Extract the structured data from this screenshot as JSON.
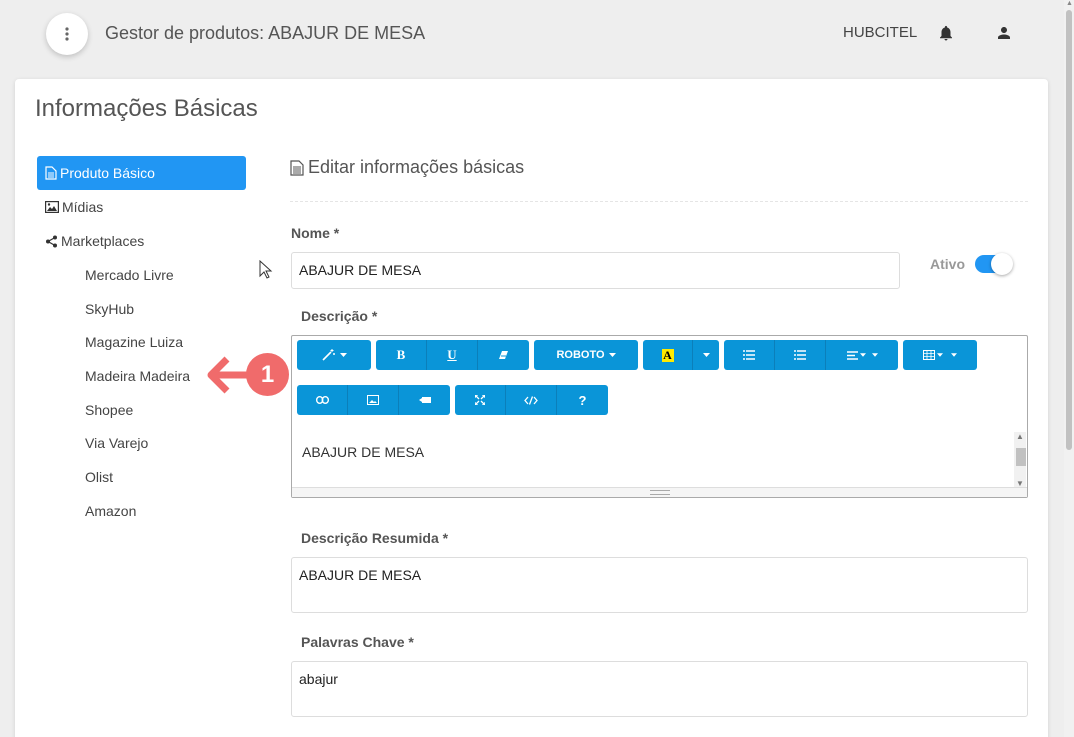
{
  "header": {
    "title": "Gestor de produtos: ABAJUR DE MESA",
    "org": "HUBCITEL"
  },
  "card": {
    "title": "Informações Básicas"
  },
  "sidebar": {
    "items": [
      {
        "label": "Produto Básico",
        "icon": "file-icon",
        "active": true
      },
      {
        "label": "Mídias",
        "icon": "image-icon"
      },
      {
        "label": "Marketplaces",
        "icon": "share-icon"
      }
    ],
    "marketplaces": [
      "Mercado Livre",
      "SkyHub",
      "Magazine Luiza",
      "Madeira Madeira",
      "Shopee",
      "Via Varejo",
      "Olist",
      "Amazon"
    ]
  },
  "annotation": {
    "badge": "1"
  },
  "form": {
    "section_title": "Editar informações básicas",
    "nome_label": "Nome *",
    "nome_value": "ABAJUR DE MESA",
    "ativo_label": "Ativo",
    "ativo_on": true,
    "descricao_label": "Descrição *",
    "descricao_value": "ABAJUR DE MESA",
    "font_label": "ROBOTO",
    "resumida_label": "Descrição Resumida *",
    "resumida_value": "ABAJUR DE MESA",
    "palavras_label": "Palavras Chave *",
    "palavras_value": "abajur"
  },
  "colors": {
    "primary": "#2196f3",
    "toolbar": "#0a95d8",
    "annotation": "#f06b6b"
  }
}
